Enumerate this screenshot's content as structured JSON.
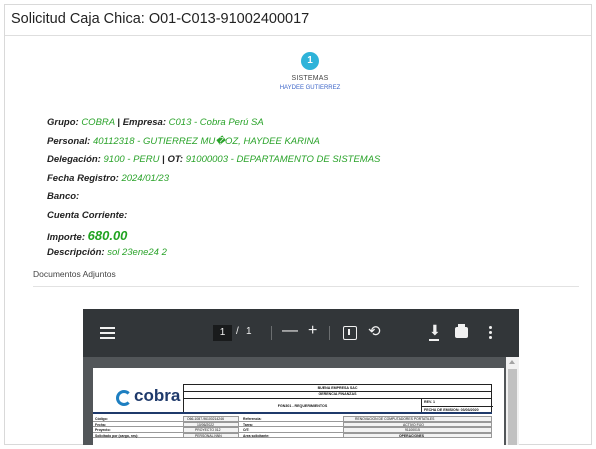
{
  "header": {
    "title": "Solicitud Caja Chica: O01-C013-91002400017"
  },
  "stepper": {
    "step_number": "1",
    "step_label": "SISTEMAS",
    "step_user": "HAYDEE GUTIERREZ"
  },
  "details": {
    "grupo_label": "Grupo:",
    "grupo_value": "COBRA",
    "separator": "|",
    "empresa_label": "Empresa:",
    "empresa_value": "C013 - Cobra Perú SA",
    "personal_label": "Personal:",
    "personal_value": "40112318 - GUTIERREZ MU�OZ, HAYDEE KARINA",
    "delegacion_label": "Delegación:",
    "delegacion_value": "9100 - PERU",
    "ot_label": "OT:",
    "ot_value": "91000003 - DEPARTAMENTO DE SISTEMAS",
    "fecha_label": "Fecha Registro:",
    "fecha_value": "2024/01/23",
    "banco_label": "Banco:",
    "cuenta_label": "Cuenta Corriente:",
    "importe_label": "Importe:",
    "importe_value": "680.00",
    "descripcion_label": "Descripción:",
    "descripcion_value": "sol 23ene24 2"
  },
  "attachments": {
    "label": "Documentos Adjuntos"
  },
  "pdf_viewer": {
    "current_page": "1",
    "page_separator": "/",
    "total_pages": "1",
    "zoom_out": "—",
    "zoom_in": "+",
    "icons": [
      "menu-icon",
      "fit-page-icon",
      "rotate-icon",
      "download-icon",
      "print-icon",
      "more-options-icon"
    ],
    "document": {
      "logo_text": "cobra",
      "company": "BUENA EMPRESA SAC",
      "department": "GERENCIA FINANZAS",
      "form_title": "FGN301 - REQUERIMIENTOS",
      "rev": "REV. 1",
      "issue_date": "FECHA DE EMISION: 03/03/2020",
      "rows": [
        {
          "l1": "Código:",
          "v1": "O66-1087-96100214246",
          "l2": "Referencia:",
          "v2": "RENOVACION DE COMPUTADORES PORTATILES"
        },
        {
          "l1": "Fecha:",
          "v1": "10/06/2022",
          "l2": "Tarea:",
          "v2": "ACTIVO FIJO"
        },
        {
          "l1": "Proyecto:",
          "v1": "PROYECTO 012",
          "l2": "O/T:",
          "v2": "91100015"
        },
        {
          "l1": "Solicitado por (cargo, nrs):",
          "v1": "PERSONAL.NNN",
          "l2": "Area solicitante:",
          "v2": "OPERACIONES"
        }
      ]
    }
  },
  "colors": {
    "accent": "#2eb3d9",
    "value_green": "#2aa32a",
    "link_blue": "#3d66c8",
    "viewer_toolbar": "#323639"
  }
}
